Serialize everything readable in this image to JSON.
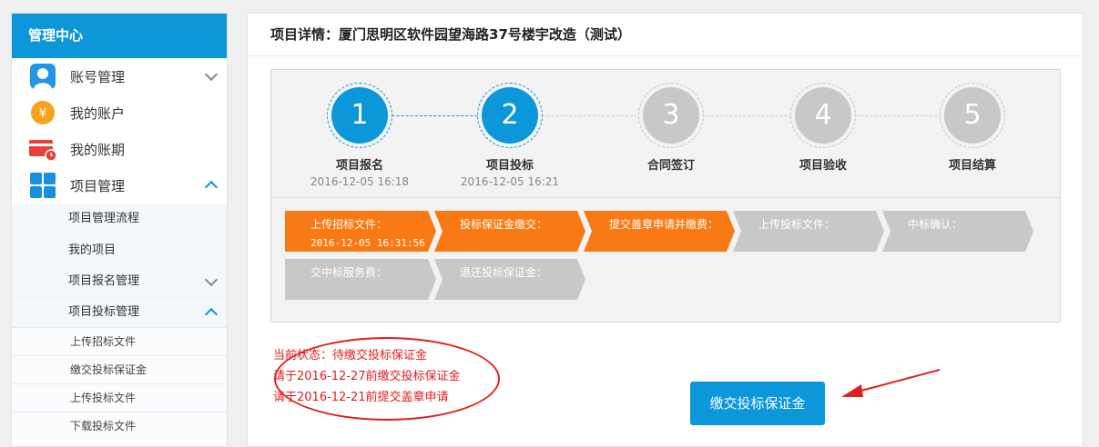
{
  "sidebar": {
    "header": "管理中心",
    "items": [
      {
        "label": "账号管理"
      },
      {
        "label": "我的账户"
      },
      {
        "label": "我的账期"
      },
      {
        "label": "项目管理"
      }
    ],
    "project_sub": [
      {
        "label": "项目管理流程"
      },
      {
        "label": "我的项目"
      },
      {
        "label": "项目报名管理"
      },
      {
        "label": "项目投标管理"
      }
    ],
    "bid_sub": [
      {
        "label": "上传招标文件"
      },
      {
        "label": "缴交投标保证金"
      },
      {
        "label": "上传投标文件"
      },
      {
        "label": "下载投标文件"
      }
    ]
  },
  "main": {
    "title": "项目详情：厦门思明区软件园望海路37号楼宇改造（测试）",
    "steps": [
      {
        "num": "1",
        "name": "项目报名",
        "date": "2016-12-05 16:18",
        "active": true
      },
      {
        "num": "2",
        "name": "项目投标",
        "date": "2016-12-05 16:21",
        "active": true
      },
      {
        "num": "3",
        "name": "合同签订",
        "date": "",
        "active": false
      },
      {
        "num": "4",
        "name": "项目验收",
        "date": "",
        "active": false
      },
      {
        "num": "5",
        "name": "项目结算",
        "date": "",
        "active": false
      }
    ],
    "flow": [
      {
        "label": "上传招标文件：",
        "time": "2016-12-05 16:31:56",
        "state": "done"
      },
      {
        "label": "投标保证金缴交：",
        "time": "",
        "state": "done"
      },
      {
        "label": "提交盖章申请并缴费：",
        "time": "",
        "state": "done"
      },
      {
        "label": "上传投标文件：",
        "time": "",
        "state": "pending"
      },
      {
        "label": "中标确认：",
        "time": "",
        "state": "pending"
      },
      {
        "label": "交中标服务费：",
        "time": "",
        "state": "pending"
      },
      {
        "label": "退还投标保证金：",
        "time": "",
        "state": "pending"
      }
    ],
    "status_lines": [
      "当前状态：待缴交投标保证金",
      "请于2016-12-27前缴交投标保证金",
      "请于2016-12-21前提交盖章申请"
    ],
    "pay_button": "缴交投标保证金"
  },
  "colors": {
    "accent": "#0b97d9",
    "orange": "#f97a14",
    "inactive": "#c8c8c8",
    "alert": "#e0201e"
  }
}
